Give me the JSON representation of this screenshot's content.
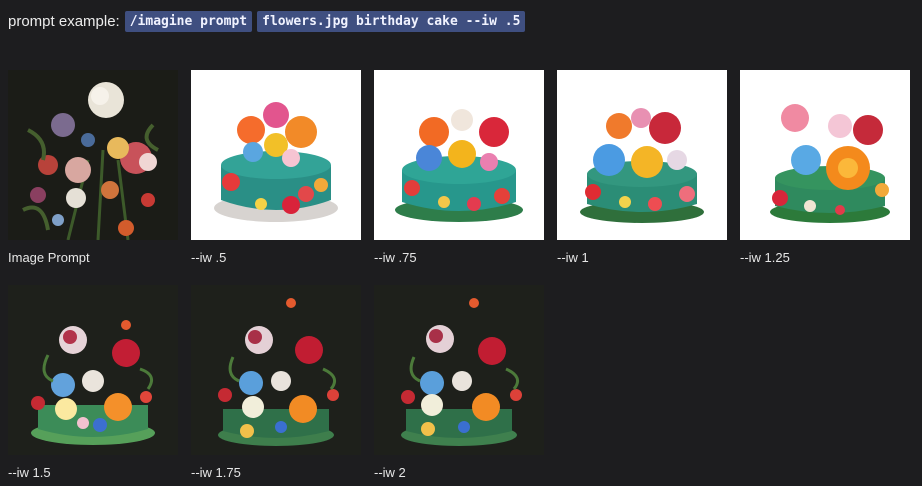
{
  "prompt": {
    "label": "prompt example:",
    "code_1": "/imagine prompt",
    "code_2": "flowers.jpg birthday cake --iw .5"
  },
  "images": [
    {
      "caption": "Image Prompt",
      "icon": "flower-painting-image",
      "bg": "#1b1c17"
    },
    {
      "caption": "--iw .5",
      "icon": "flower-cake-image",
      "bg": "#ffffff"
    },
    {
      "caption": "--iw .75",
      "icon": "flower-cake-image",
      "bg": "#ffffff"
    },
    {
      "caption": "--iw 1",
      "icon": "flower-cake-image",
      "bg": "#ffffff"
    },
    {
      "caption": "--iw 1.25",
      "icon": "flower-cake-image",
      "bg": "#ffffff"
    },
    {
      "caption": "--iw 1.5",
      "icon": "flower-cake-painting-image",
      "bg": "#1e201b"
    },
    {
      "caption": "--iw 1.75",
      "icon": "flower-cake-painting-image",
      "bg": "#1e201b"
    },
    {
      "caption": "--iw 2",
      "icon": "flower-cake-painting-image",
      "bg": "#1e201b"
    }
  ]
}
